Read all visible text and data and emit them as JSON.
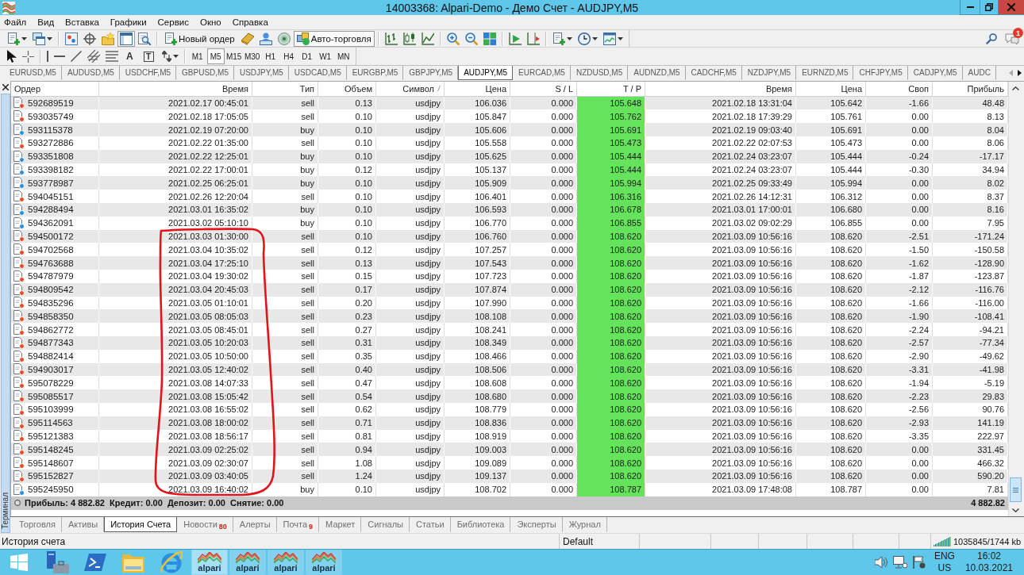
{
  "window": {
    "title": "14003368: Alpari-Demo - Демо Счет - AUDJPY,M5"
  },
  "menu": [
    "Файл",
    "Вид",
    "Вставка",
    "Графики",
    "Сервис",
    "Окно",
    "Справка"
  ],
  "toolbar": [
    {
      "kind": "dropdown",
      "pressed": false
    },
    {
      "kind": "dropdown",
      "pressed": false
    },
    {
      "kind": "separator"
    },
    {
      "kind": "icon",
      "pressed": false
    },
    {
      "kind": "icon",
      "pressed": false
    },
    {
      "kind": "icon",
      "pressed": false
    },
    {
      "kind": "icon",
      "pressed": true
    },
    {
      "kind": "icon",
      "pressed": false
    },
    {
      "kind": "separator"
    },
    {
      "kind": "button",
      "label": "Новый ордер",
      "pressed": false
    },
    {
      "kind": "icon",
      "pressed": false
    },
    {
      "kind": "icon",
      "pressed": false
    },
    {
      "kind": "icon",
      "pressed": false
    },
    {
      "kind": "button",
      "label": "Авто-торговля",
      "pressed": true
    },
    {
      "kind": "separator"
    },
    {
      "kind": "icon",
      "pressed": false
    },
    {
      "kind": "icon",
      "pressed": false
    },
    {
      "kind": "icon",
      "pressed": false
    },
    {
      "kind": "separator"
    },
    {
      "kind": "icon",
      "pressed": false
    },
    {
      "kind": "icon",
      "pressed": false
    },
    {
      "kind": "icon",
      "pressed": false
    },
    {
      "kind": "separator"
    },
    {
      "kind": "icon",
      "pressed": false
    },
    {
      "kind": "icon",
      "pressed": false
    },
    {
      "kind": "separator"
    },
    {
      "kind": "dropdown",
      "pressed": false
    },
    {
      "kind": "dropdown",
      "pressed": false
    },
    {
      "kind": "dropdown",
      "pressed": false
    }
  ],
  "notifications": {
    "badge": "1"
  },
  "drawing_toolbar": [
    {
      "kind": "icon"
    },
    {
      "kind": "icon"
    },
    {
      "kind": "separator"
    },
    {
      "kind": "icon"
    },
    {
      "kind": "icon"
    },
    {
      "kind": "icon"
    },
    {
      "kind": "icon"
    },
    {
      "kind": "icon"
    },
    {
      "kind": "glyph",
      "label": "A"
    },
    {
      "kind": "boxed_glyph",
      "label": "T"
    },
    {
      "kind": "dropdown"
    }
  ],
  "timeframes": [
    {
      "label": "M1",
      "selected": false
    },
    {
      "label": "M5",
      "selected": true
    },
    {
      "label": "M15",
      "selected": false
    },
    {
      "label": "M30",
      "selected": false
    },
    {
      "label": "H1",
      "selected": false
    },
    {
      "label": "H4",
      "selected": false
    },
    {
      "label": "D1",
      "selected": false
    },
    {
      "label": "W1",
      "selected": false
    },
    {
      "label": "MN",
      "selected": false
    }
  ],
  "chart_tabs": [
    {
      "label": "EURUSD,M5",
      "selected": false
    },
    {
      "label": "AUDUSD,M5",
      "selected": false
    },
    {
      "label": "USDCHF,M5",
      "selected": false
    },
    {
      "label": "GBPUSD,M5",
      "selected": false
    },
    {
      "label": "USDJPY,M5",
      "selected": false
    },
    {
      "label": "USDCAD,M5",
      "selected": false
    },
    {
      "label": "EURGBP,M5",
      "selected": false
    },
    {
      "label": "GBPJPY,M5",
      "selected": false
    },
    {
      "label": "AUDJPY,M5",
      "selected": true
    },
    {
      "label": "EURCAD,M5",
      "selected": false
    },
    {
      "label": "NZDUSD,M5",
      "selected": false
    },
    {
      "label": "AUDNZD,M5",
      "selected": false
    },
    {
      "label": "CADCHF,M5",
      "selected": false
    },
    {
      "label": "NZDJPY,M5",
      "selected": false
    },
    {
      "label": "EURNZD,M5",
      "selected": false
    },
    {
      "label": "CHFJPY,M5",
      "selected": false
    },
    {
      "label": "CADJPY,M5",
      "selected": false
    },
    {
      "label": "AUDC",
      "selected": false
    }
  ],
  "terminal_panel": {
    "label": "Терминал"
  },
  "table": {
    "columns": [
      {
        "label": "Ордер",
        "sorted": false
      },
      {
        "label": "Время",
        "sorted": false
      },
      {
        "label": "Тип",
        "sorted": false
      },
      {
        "label": "Объем",
        "sorted": false
      },
      {
        "label": "Символ",
        "sorted": true
      },
      {
        "label": "Цена",
        "sorted": false
      },
      {
        "label": "S / L",
        "sorted": false
      },
      {
        "label": "T / P",
        "sorted": false
      },
      {
        "label": "Время",
        "sorted": false
      },
      {
        "label": "Цена",
        "sorted": false
      },
      {
        "label": "Своп",
        "sorted": false
      },
      {
        "label": "Прибыль",
        "sorted": false
      }
    ],
    "rows": [
      {
        "color": "#e2502a",
        "tp_hit": true,
        "cells": [
          "592689519",
          "2021.02.17 00:45:01",
          "sell",
          "0.13",
          "usdjpy",
          "106.036",
          "0.000",
          "105.648",
          "2021.02.18 13:31:04",
          "105.642",
          "-1.66",
          "48.48"
        ]
      },
      {
        "color": "#e2502a",
        "tp_hit": true,
        "cells": [
          "593035749",
          "2021.02.18 17:05:05",
          "sell",
          "0.10",
          "usdjpy",
          "105.847",
          "0.000",
          "105.762",
          "2021.02.18 17:39:29",
          "105.761",
          "0.00",
          "8.13"
        ]
      },
      {
        "color": "#2d8fd9",
        "tp_hit": true,
        "cells": [
          "593115378",
          "2021.02.19 07:20:00",
          "buy",
          "0.10",
          "usdjpy",
          "105.606",
          "0.000",
          "105.691",
          "2021.02.19 09:03:40",
          "105.691",
          "0.00",
          "8.04"
        ]
      },
      {
        "color": "#e2502a",
        "tp_hit": true,
        "cells": [
          "593272886",
          "2021.02.22 01:35:00",
          "sell",
          "0.10",
          "usdjpy",
          "105.558",
          "0.000",
          "105.473",
          "2021.02.22 02:07:53",
          "105.473",
          "0.00",
          "8.06"
        ]
      },
      {
        "color": "#2d8fd9",
        "tp_hit": true,
        "cells": [
          "593351808",
          "2021.02.22 12:25:01",
          "buy",
          "0.10",
          "usdjpy",
          "105.625",
          "0.000",
          "105.444",
          "2021.02.24 03:23:07",
          "105.444",
          "-0.24",
          "-17.17"
        ]
      },
      {
        "color": "#2d8fd9",
        "tp_hit": true,
        "cells": [
          "593398182",
          "2021.02.22 17:00:01",
          "buy",
          "0.12",
          "usdjpy",
          "105.137",
          "0.000",
          "105.444",
          "2021.02.24 03:23:07",
          "105.444",
          "-0.30",
          "34.94"
        ]
      },
      {
        "color": "#2d8fd9",
        "tp_hit": true,
        "cells": [
          "593778987",
          "2021.02.25 06:25:01",
          "buy",
          "0.10",
          "usdjpy",
          "105.909",
          "0.000",
          "105.994",
          "2021.02.25 09:33:49",
          "105.994",
          "0.00",
          "8.02"
        ]
      },
      {
        "color": "#e2502a",
        "tp_hit": true,
        "cells": [
          "594045151",
          "2021.02.26 12:20:04",
          "sell",
          "0.10",
          "usdjpy",
          "106.401",
          "0.000",
          "106.316",
          "2021.02.26 14:12:31",
          "106.312",
          "0.00",
          "8.37"
        ]
      },
      {
        "color": "#2d8fd9",
        "tp_hit": true,
        "cells": [
          "594288494",
          "2021.03.01 16:35:02",
          "buy",
          "0.10",
          "usdjpy",
          "106.593",
          "0.000",
          "106.678",
          "2021.03.01 17:00:01",
          "106.680",
          "0.00",
          "8.16"
        ]
      },
      {
        "color": "#2d8fd9",
        "tp_hit": true,
        "cells": [
          "594362091",
          "2021.03.02 05:10:10",
          "buy",
          "0.10",
          "usdjpy",
          "106.770",
          "0.000",
          "106.855",
          "2021.03.02 09:02:29",
          "106.855",
          "0.00",
          "7.95"
        ]
      },
      {
        "color": "#e2502a",
        "tp_hit": true,
        "cells": [
          "594500172",
          "2021.03.03 01:30:00",
          "sell",
          "0.10",
          "usdjpy",
          "106.760",
          "0.000",
          "108.620",
          "2021.03.09 10:56:16",
          "108.620",
          "-2.51",
          "-171.24"
        ]
      },
      {
        "color": "#e2502a",
        "tp_hit": true,
        "cells": [
          "594702568",
          "2021.03.04 10:35:02",
          "sell",
          "0.12",
          "usdjpy",
          "107.257",
          "0.000",
          "108.620",
          "2021.03.09 10:56:16",
          "108.620",
          "-1.50",
          "-150.58"
        ]
      },
      {
        "color": "#e2502a",
        "tp_hit": true,
        "cells": [
          "594763688",
          "2021.03.04 17:25:10",
          "sell",
          "0.13",
          "usdjpy",
          "107.543",
          "0.000",
          "108.620",
          "2021.03.09 10:56:16",
          "108.620",
          "-1.62",
          "-128.90"
        ]
      },
      {
        "color": "#e2502a",
        "tp_hit": true,
        "cells": [
          "594787979",
          "2021.03.04 19:30:02",
          "sell",
          "0.15",
          "usdjpy",
          "107.723",
          "0.000",
          "108.620",
          "2021.03.09 10:56:16",
          "108.620",
          "-1.87",
          "-123.87"
        ]
      },
      {
        "color": "#e2502a",
        "tp_hit": true,
        "cells": [
          "594809542",
          "2021.03.04 20:45:03",
          "sell",
          "0.17",
          "usdjpy",
          "107.874",
          "0.000",
          "108.620",
          "2021.03.09 10:56:16",
          "108.620",
          "-2.12",
          "-116.76"
        ]
      },
      {
        "color": "#e2502a",
        "tp_hit": true,
        "cells": [
          "594835296",
          "2021.03.05 01:10:01",
          "sell",
          "0.20",
          "usdjpy",
          "107.990",
          "0.000",
          "108.620",
          "2021.03.09 10:56:16",
          "108.620",
          "-1.66",
          "-116.00"
        ]
      },
      {
        "color": "#e2502a",
        "tp_hit": true,
        "cells": [
          "594858350",
          "2021.03.05 08:05:03",
          "sell",
          "0.23",
          "usdjpy",
          "108.108",
          "0.000",
          "108.620",
          "2021.03.09 10:56:16",
          "108.620",
          "-1.90",
          "-108.41"
        ]
      },
      {
        "color": "#e2502a",
        "tp_hit": true,
        "cells": [
          "594862772",
          "2021.03.05 08:45:01",
          "sell",
          "0.27",
          "usdjpy",
          "108.241",
          "0.000",
          "108.620",
          "2021.03.09 10:56:16",
          "108.620",
          "-2.24",
          "-94.21"
        ]
      },
      {
        "color": "#e2502a",
        "tp_hit": true,
        "cells": [
          "594877343",
          "2021.03.05 10:20:03",
          "sell",
          "0.31",
          "usdjpy",
          "108.349",
          "0.000",
          "108.620",
          "2021.03.09 10:56:16",
          "108.620",
          "-2.57",
          "-77.34"
        ]
      },
      {
        "color": "#e2502a",
        "tp_hit": true,
        "cells": [
          "594882414",
          "2021.03.05 10:50:00",
          "sell",
          "0.35",
          "usdjpy",
          "108.466",
          "0.000",
          "108.620",
          "2021.03.09 10:56:16",
          "108.620",
          "-2.90",
          "-49.62"
        ]
      },
      {
        "color": "#e2502a",
        "tp_hit": true,
        "cells": [
          "594903017",
          "2021.03.05 12:40:02",
          "sell",
          "0.40",
          "usdjpy",
          "108.506",
          "0.000",
          "108.620",
          "2021.03.09 10:56:16",
          "108.620",
          "-3.31",
          "-41.98"
        ]
      },
      {
        "color": "#e2502a",
        "tp_hit": true,
        "cells": [
          "595078229",
          "2021.03.08 14:07:33",
          "sell",
          "0.47",
          "usdjpy",
          "108.608",
          "0.000",
          "108.620",
          "2021.03.09 10:56:16",
          "108.620",
          "-1.94",
          "-5.19"
        ]
      },
      {
        "color": "#e2502a",
        "tp_hit": true,
        "cells": [
          "595085517",
          "2021.03.08 15:05:42",
          "sell",
          "0.54",
          "usdjpy",
          "108.680",
          "0.000",
          "108.620",
          "2021.03.09 10:56:16",
          "108.620",
          "-2.23",
          "29.83"
        ]
      },
      {
        "color": "#e2502a",
        "tp_hit": true,
        "cells": [
          "595103999",
          "2021.03.08 16:55:02",
          "sell",
          "0.62",
          "usdjpy",
          "108.779",
          "0.000",
          "108.620",
          "2021.03.09 10:56:16",
          "108.620",
          "-2.56",
          "90.76"
        ]
      },
      {
        "color": "#e2502a",
        "tp_hit": true,
        "cells": [
          "595114563",
          "2021.03.08 18:00:02",
          "sell",
          "0.71",
          "usdjpy",
          "108.836",
          "0.000",
          "108.620",
          "2021.03.09 10:56:16",
          "108.620",
          "-2.93",
          "141.19"
        ]
      },
      {
        "color": "#e2502a",
        "tp_hit": true,
        "cells": [
          "595121383",
          "2021.03.08 18:56:17",
          "sell",
          "0.81",
          "usdjpy",
          "108.919",
          "0.000",
          "108.620",
          "2021.03.09 10:56:16",
          "108.620",
          "-3.35",
          "222.97"
        ]
      },
      {
        "color": "#e2502a",
        "tp_hit": true,
        "cells": [
          "595148245",
          "2021.03.09 02:25:02",
          "sell",
          "0.94",
          "usdjpy",
          "109.003",
          "0.000",
          "108.620",
          "2021.03.09 10:56:16",
          "108.620",
          "0.00",
          "331.45"
        ]
      },
      {
        "color": "#e2502a",
        "tp_hit": true,
        "cells": [
          "595148607",
          "2021.03.09 02:30:07",
          "sell",
          "1.08",
          "usdjpy",
          "109.089",
          "0.000",
          "108.620",
          "2021.03.09 10:56:16",
          "108.620",
          "0.00",
          "466.32"
        ]
      },
      {
        "color": "#e2502a",
        "tp_hit": true,
        "cells": [
          "595152827",
          "2021.03.09 03:40:05",
          "sell",
          "1.24",
          "usdjpy",
          "109.137",
          "0.000",
          "108.620",
          "2021.03.09 10:56:16",
          "108.620",
          "0.00",
          "590.20"
        ]
      },
      {
        "color": "#2d8fd9",
        "tp_hit": true,
        "cells": [
          "595245950",
          "2021.03.09 16:40:02",
          "buy",
          "0.10",
          "usdjpy",
          "108.702",
          "0.000",
          "108.787",
          "2021.03.09 17:48:08",
          "108.787",
          "0.00",
          "7.81"
        ]
      }
    ],
    "summary": {
      "text": "Прибыль: 4 882.82  Кредит: 0.00  Депозит: 0.00  Снятие: 0.00",
      "total": "4 882.82"
    }
  },
  "bottom_tabs": [
    {
      "label": "Торговля",
      "selected": false
    },
    {
      "label": "Активы",
      "selected": false
    },
    {
      "label": "История Счета",
      "selected": true
    },
    {
      "label": "Новости",
      "badge": "80",
      "selected": false
    },
    {
      "label": "Алерты",
      "selected": false
    },
    {
      "label": "Почта",
      "badge": "9",
      "selected": false
    },
    {
      "label": "Маркет",
      "selected": false
    },
    {
      "label": "Сигналы",
      "selected": false
    },
    {
      "label": "Статьи",
      "selected": false
    },
    {
      "label": "Библиотека",
      "selected": false
    },
    {
      "label": "Эксперты",
      "selected": false
    },
    {
      "label": "Журнал",
      "selected": false
    }
  ],
  "status_bar": {
    "text": "История счета",
    "profile": "Default",
    "traffic": "1035845/1744 kb"
  },
  "taskbar": {
    "windows": [
      {
        "label": "alpari",
        "selected": true
      },
      {
        "label": "alpari",
        "selected": false
      },
      {
        "label": "alpari",
        "selected": false
      },
      {
        "label": "alpari",
        "selected": false
      }
    ],
    "language": "ENG",
    "region": "US",
    "time": "16:02",
    "date": "10.03.2021"
  }
}
